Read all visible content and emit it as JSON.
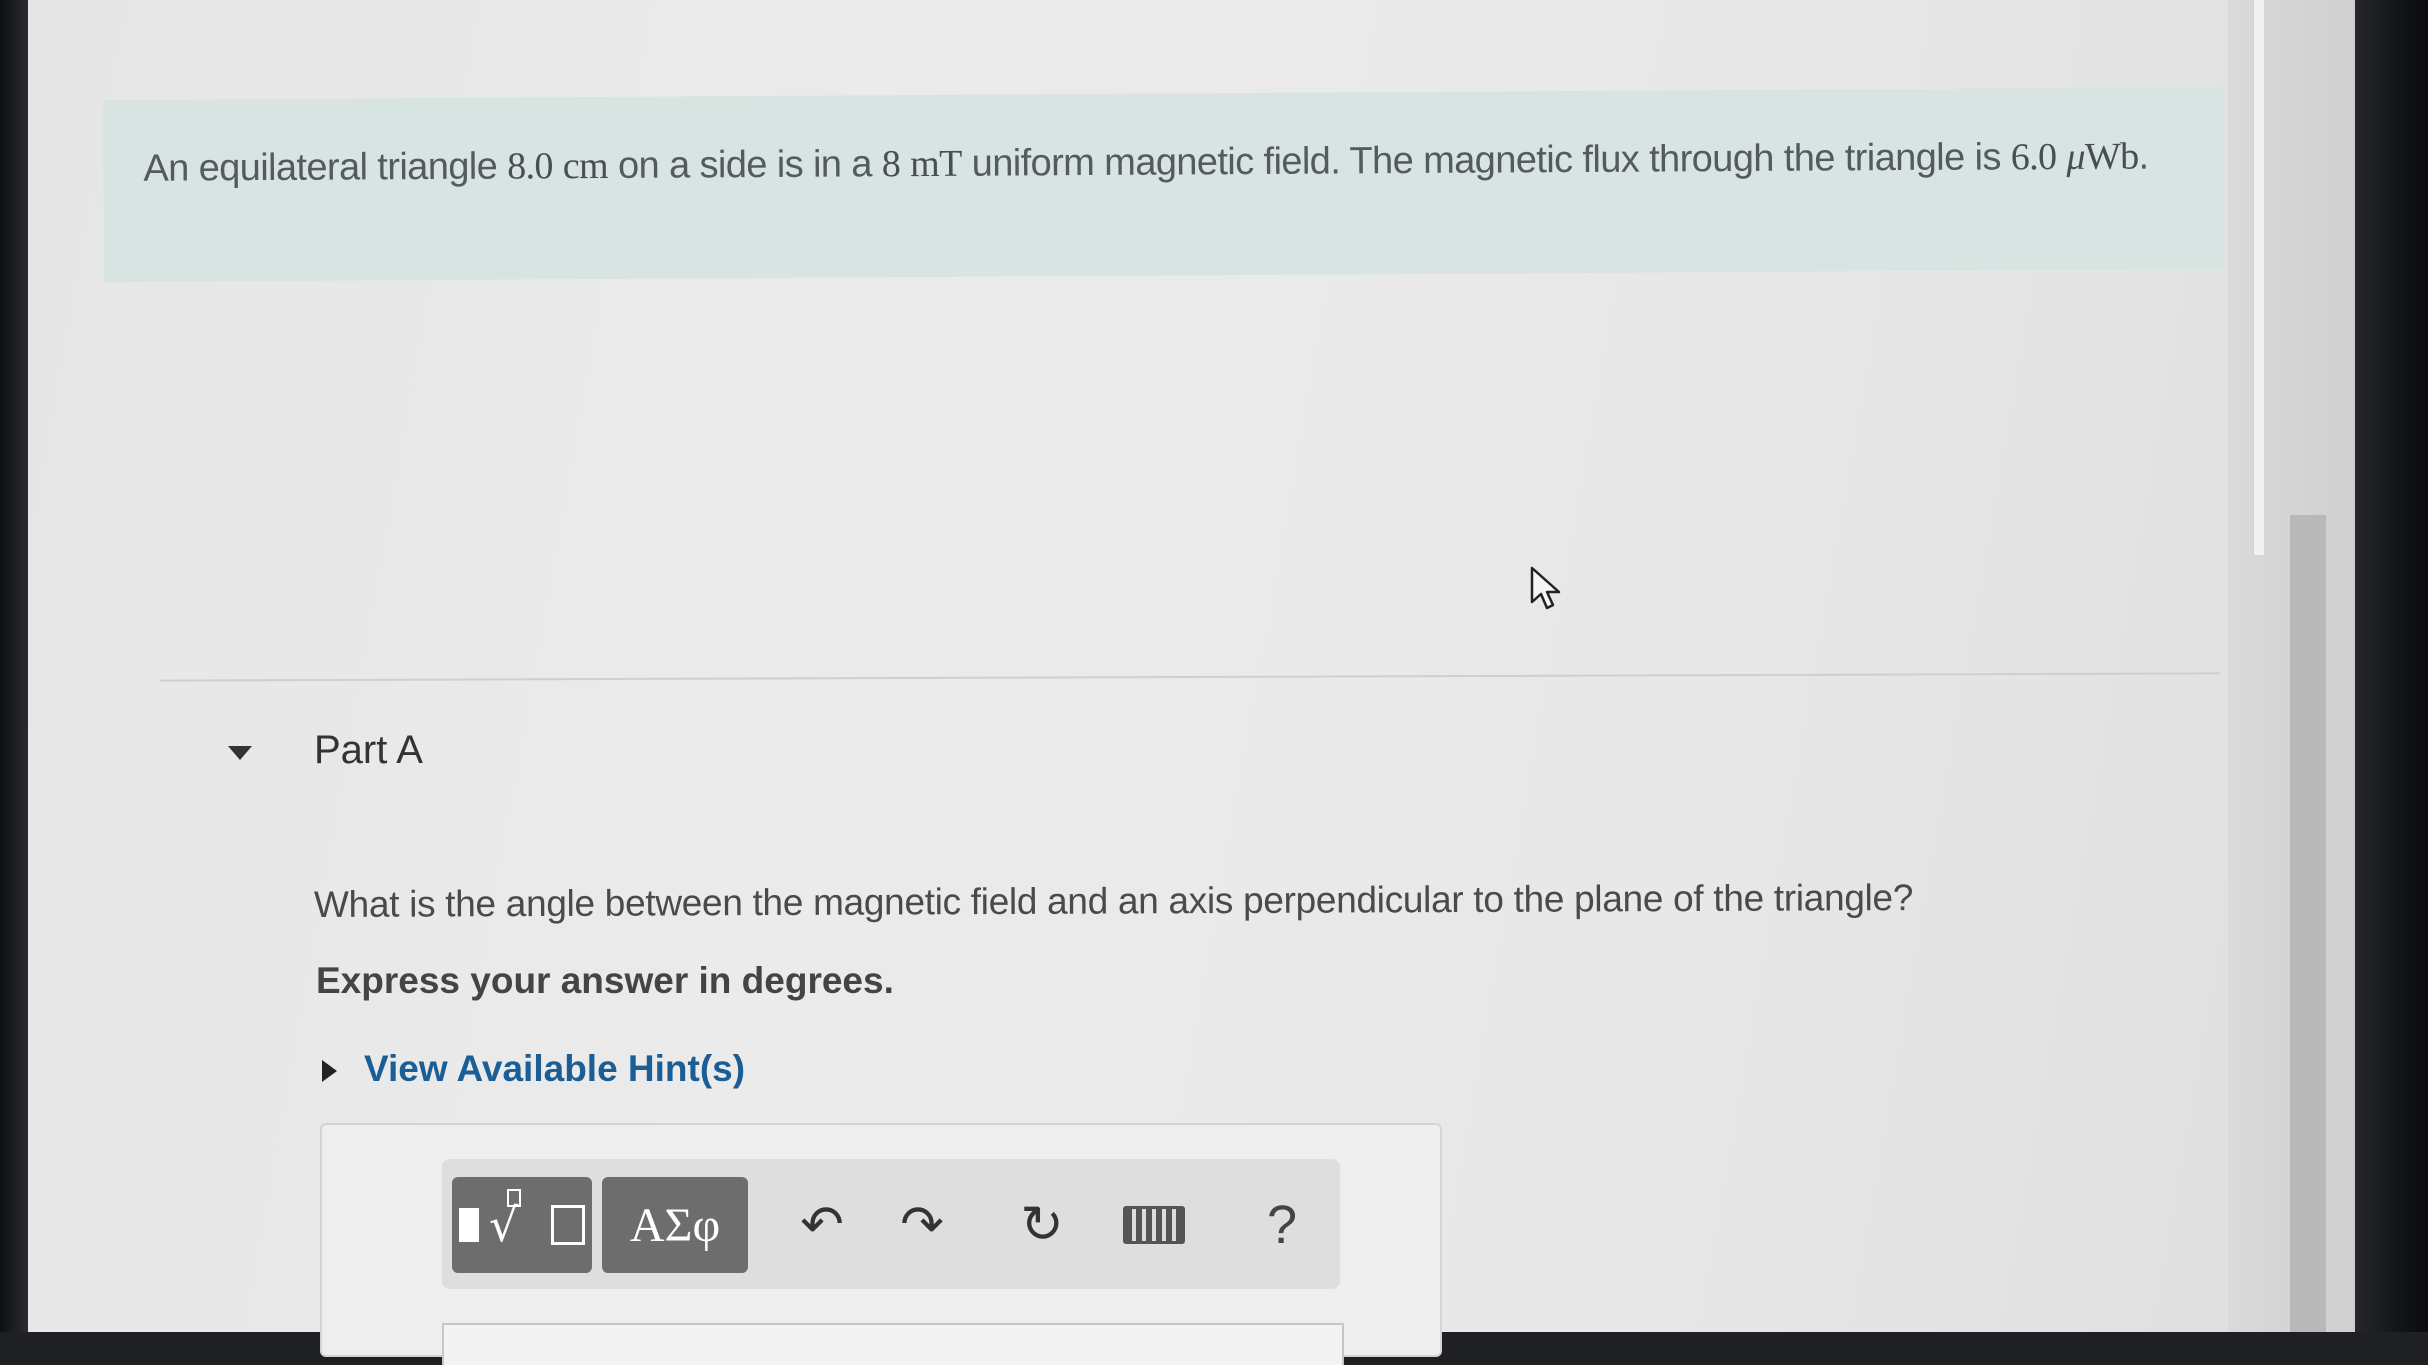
{
  "problem": {
    "intro": "An equilateral triangle ",
    "side_value": "8.0",
    "side_unit": "cm",
    "mid1": " on a side is in a ",
    "field_value": "8",
    "field_unit": "mT",
    "mid2": " uniform magnetic field. The magnetic flux through the triangle is ",
    "flux_value": "6.0",
    "flux_prefix": "μ",
    "flux_unit": "Wb",
    "end": "."
  },
  "part": {
    "title": "Part A",
    "question": "What is the angle between the magnetic field and an axis perpendicular to the plane of the triangle?",
    "instruction": "Express your answer in degrees.",
    "hint_link": "View Available Hint(s)"
  },
  "toolbar": {
    "greek_label": "ΑΣφ",
    "undo_icon": "↶",
    "redo_icon": "↷",
    "reset_icon": "↻",
    "help_label": "?"
  },
  "colors": {
    "problem_bg": "#d7e4e1",
    "link": "#1b5e96",
    "toolbar_button": "#6d6d6d"
  }
}
